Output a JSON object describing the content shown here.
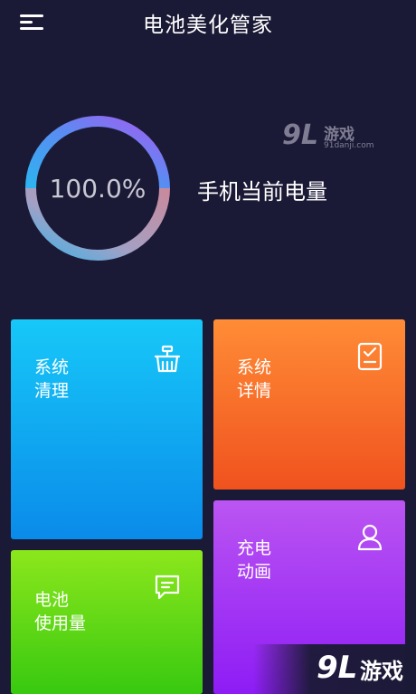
{
  "header": {
    "title": "电池美化管家"
  },
  "battery": {
    "percent_text": "100.0%",
    "level": 1.0,
    "label": "手机当前电量"
  },
  "tiles": {
    "clean": {
      "line1": "系统",
      "line2": "清理"
    },
    "detail": {
      "line1": "系统",
      "line2": "详情"
    },
    "charge": {
      "line1": "充电",
      "line2": "动画"
    },
    "usage": {
      "line1": "电池",
      "line2": "使用量"
    }
  },
  "watermark": {
    "top_num": "9L",
    "top_cn": "游戏",
    "top_url": "91danji.com",
    "bottom_num": "9L",
    "bottom_cn": "游戏"
  },
  "colors": {
    "background": "#1b1a36",
    "clean": "#17c8f8",
    "detail": "#ff8c36",
    "charge": "#bb55f2",
    "usage": "#8ce71c"
  },
  "icons": {
    "menu": "hamburger-menu-icon",
    "clean": "broom-icon",
    "detail": "checklist-icon",
    "charge": "person-icon",
    "usage": "message-icon"
  }
}
